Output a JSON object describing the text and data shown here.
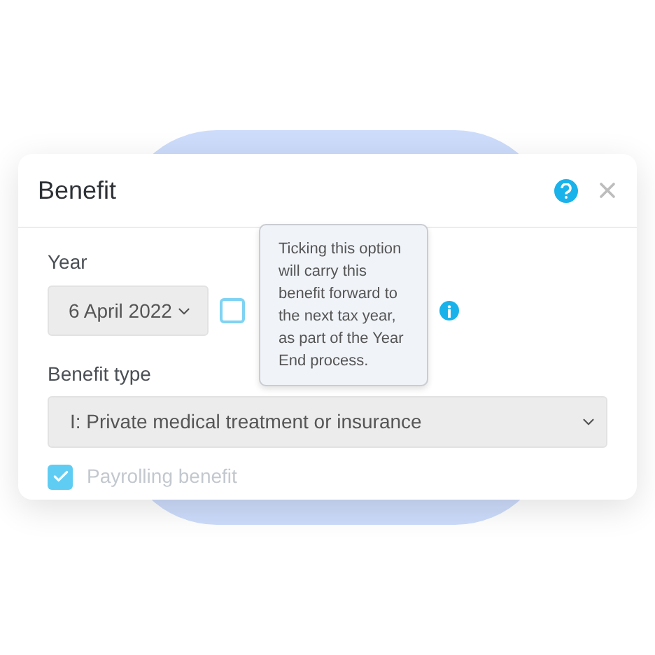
{
  "dialog": {
    "title": "Benefit"
  },
  "year": {
    "label": "Year",
    "value": "6 April 2022",
    "carry_forward": {
      "checked": false
    },
    "tooltip": "Ticking this option will carry this benefit forward to the next tax year, as part of the Year End process."
  },
  "benefit_type": {
    "label": "Benefit type",
    "value": "I: Private medical treatment or insurance"
  },
  "payrolling": {
    "label": "Payrolling benefit",
    "checked": true,
    "disabled": true
  }
}
